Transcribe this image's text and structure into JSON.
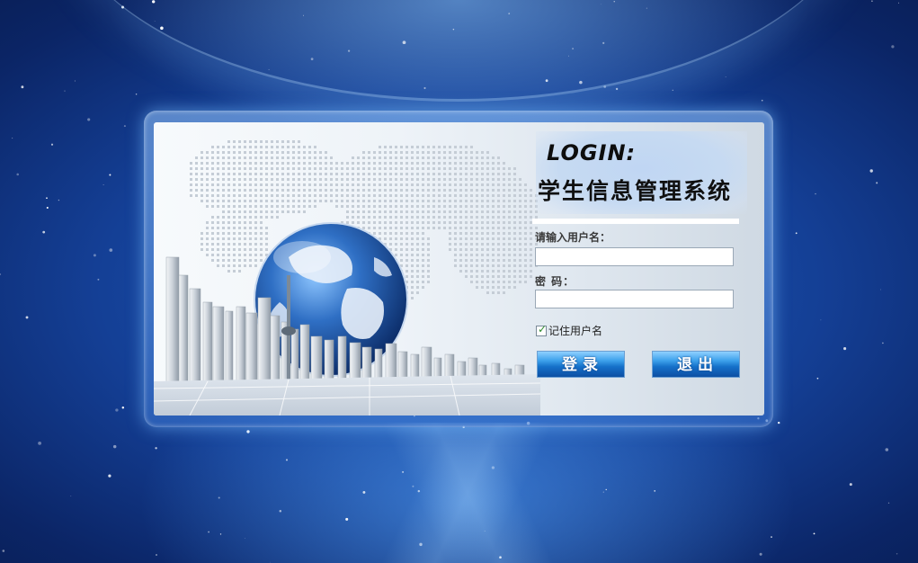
{
  "login_panel": {
    "title_en": "LOGIN:",
    "title_cn": "学生信息管理系统",
    "username_label": "请输入用户名：",
    "username_value": "",
    "password_label": "密  码：",
    "password_value": "",
    "remember_label": "记住用户名",
    "remember_checked": true,
    "login_button": "登录",
    "exit_button": "退出"
  },
  "icons": {
    "globe": "globe-illustration",
    "city": "city-skyline-illustration",
    "world_map": "dotted-world-map",
    "check": "check-icon"
  },
  "colors": {
    "background_blue": "#143f95",
    "button_blue": "#1570c9",
    "check_green": "#2d8a2d"
  }
}
